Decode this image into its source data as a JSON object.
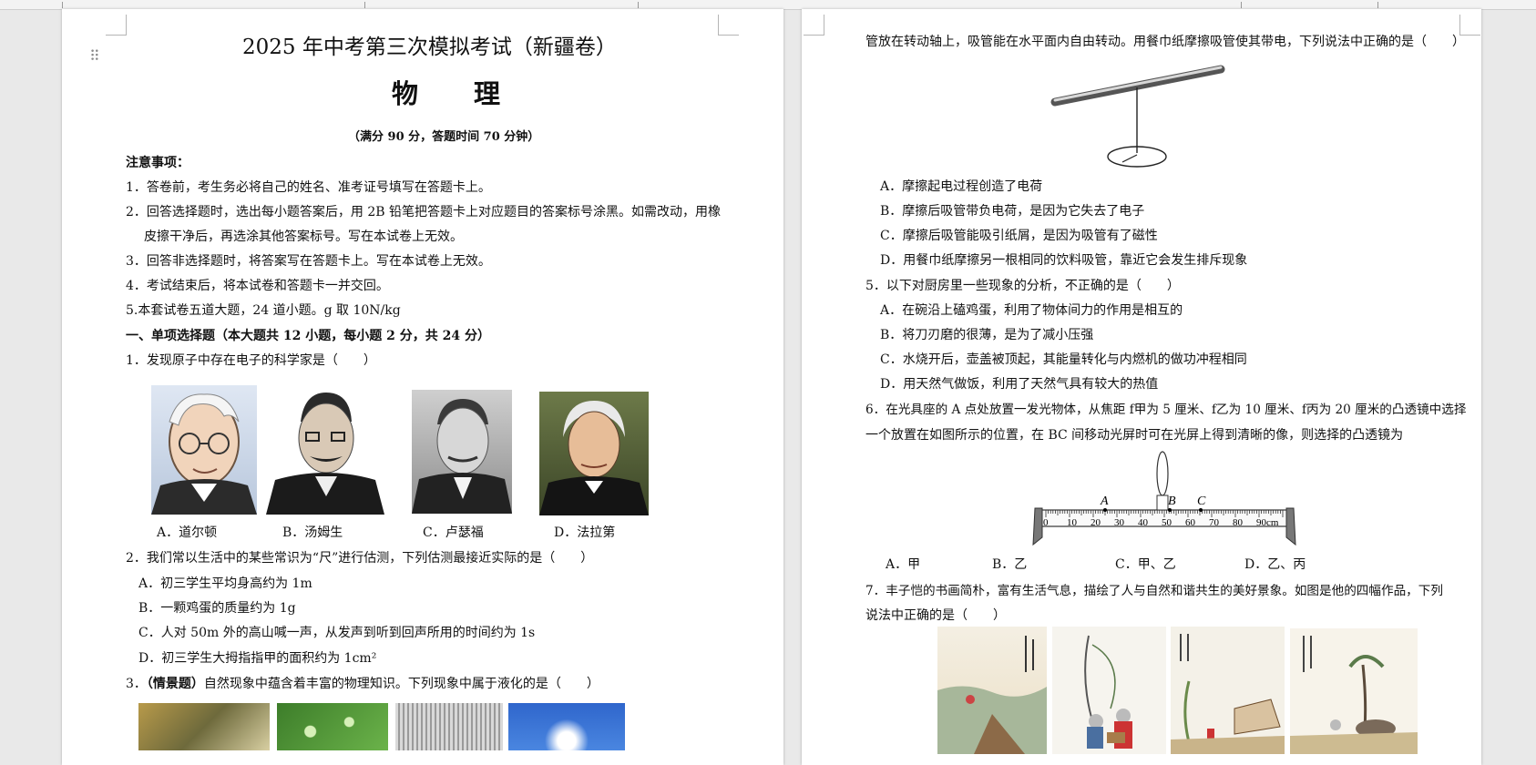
{
  "left_page": {
    "title": "2025 年中考第三次模拟考试（新疆卷）",
    "subject": "物　理",
    "full_marks": "（满分 90 分，答题时间 70 分钟）",
    "notice_heading": "注意事项：",
    "notices": [
      "1．答卷前，考生务必将自己的姓名、准考证号填写在答题卡上。",
      "2．回答选择题时，选出每小题答案后，用 2B 铅笔把答题卡上对应题目的答案标号涂黑。如需改动，用橡",
      "皮擦干净后，再选涂其他答案标号。写在本试卷上无效。",
      "3．回答非选择题时，将答案写在答题卡上。写在本试卷上无效。",
      "4．考试结束后，将本试卷和答题卡一并交回。",
      "5.本套试卷五道大题，24 道小题。g 取 10N/kg"
    ],
    "section1": "一、单项选择题（本大题共 12 小题，每小题 2 分，共 24 分）",
    "q1": {
      "stem": "1．发现原子中存在电子的科学家是（　　）",
      "options": [
        "A．道尔顿",
        "B．汤姆生",
        "C．卢瑟福",
        "D．法拉第"
      ]
    },
    "q2": {
      "stem": "2．我们常以生活中的某些常识为“尺”进行估测，下列估测最接近实际的是（　　）",
      "options": [
        "A．初三学生平均身高约为 1m",
        "B．一颗鸡蛋的质量约为 1g",
        "C．人对 50m 外的高山喊一声，从发声到听到回声所用的时间约为 1s",
        "D．初三学生大拇指指甲的面积约为 1cm²"
      ]
    },
    "q3": {
      "tag": "（情景题）",
      "stem": "自然现象中蕴含着丰富的物理知识。下列现象中属于液化的是（　　）",
      "prefix": "3．"
    }
  },
  "right_page": {
    "q4_stem": "管放在转动轴上，吸管能在水平面内自由转动。用餐巾纸摩擦吸管使其带电，下列说法中正确的是（　　）",
    "q4_options": [
      "A．摩擦起电过程创造了电荷",
      "B．摩擦后吸管带负电荷，是因为它失去了电子",
      "C．摩擦后吸管能吸引纸屑，是因为吸管有了磁性",
      "D．用餐巾纸摩擦另一根相同的饮料吸管，靠近它会发生排斥现象"
    ],
    "q5": {
      "stem": "5．以下对厨房里一些现象的分析，不正确的是（　　）",
      "options": [
        "A．在碗沿上磕鸡蛋，利用了物体间力的作用是相互的",
        "B．将刀刃磨的很薄，是为了减小压强",
        "C．水烧开后，壶盖被顶起，其能量转化与内燃机的做功冲程相同",
        "D．用天然气做饭，利用了天然气具有较大的热值"
      ]
    },
    "q6": {
      "stem_line1": "6．在光具座的 A 点处放置一发光物体，从焦距 f甲为 5 厘米、f乙为 10 厘米、f丙为 20 厘米的凸透镜中选择",
      "stem_line2": "一个放置在如图所示的位置，在 BC 间移动光屏时可在光屏上得到清晰的像，则选择的凸透镜为",
      "bench_labels": {
        "a": "A",
        "b": "B",
        "c": "C"
      },
      "scale": [
        "0",
        "10",
        "20",
        "30",
        "40",
        "50",
        "60",
        "70",
        "80",
        "90cm"
      ],
      "options": [
        "A．甲",
        "B．乙",
        "C．甲、乙",
        "D．乙、丙"
      ]
    },
    "q7": {
      "stem_line1": "7．丰子恺的书画简朴，富有生活气息，描绘了人与自然和谐共生的美好景象。如图是他的四幅作品，下列",
      "stem_line2": "说法中正确的是（　　）"
    }
  }
}
